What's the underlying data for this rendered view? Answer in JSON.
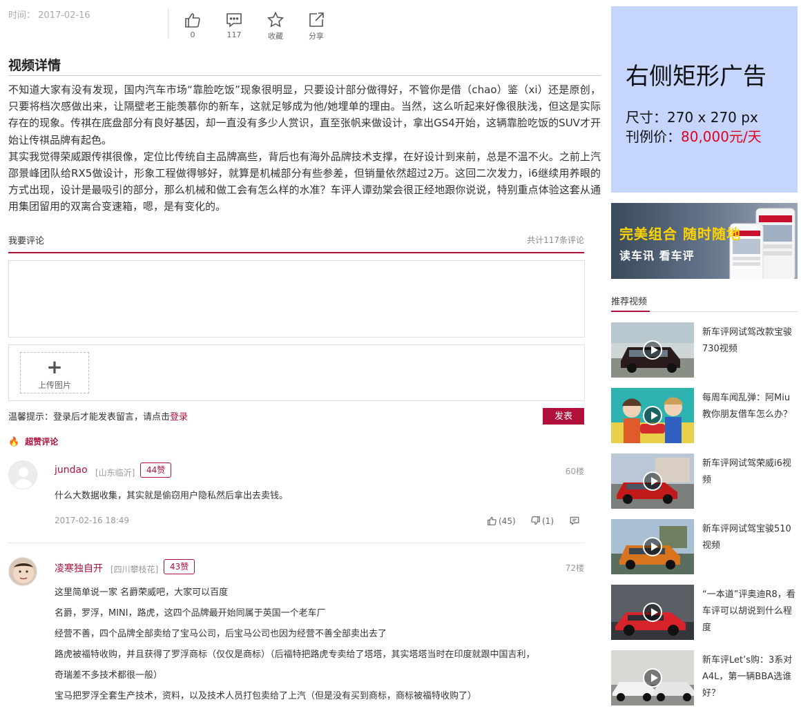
{
  "meta": {
    "time_label": "时间：",
    "time_value": "2017-02-16"
  },
  "actions": [
    {
      "icon": "thumb-up-icon",
      "label": "0"
    },
    {
      "icon": "comment-icon",
      "label": "117"
    },
    {
      "icon": "star-icon",
      "label": "收藏"
    },
    {
      "icon": "share-icon",
      "label": "分享"
    }
  ],
  "section_title": "视频详情",
  "description": [
    "不知道大家有没有发现，国内汽车市场“靠脸吃饭”现象很明显，只要设计部分做得好，不管你是借（chao）鉴（xi）还是原创，只要将档次感做出来，让隔壁老王能羡慕你的新车，这就足够成为他/她埋单的理由。当然，这么听起来好像很肤浅，但这是实际存在的现象。传祺在底盘部分有良好基因，却一直没有多少人赏识，直至张帆来做设计，拿出GS4开始，这辆靠脸吃饭的SUV才开始让传祺品牌有起色。",
    "其实我觉得荣威跟传祺很像，定位比传统自主品牌高些，背后也有海外品牌技术支撑，在好设计到来前，总是不温不火。之前上汽邵景峰团队给RX5做设计，形象工程做得够好，就算是机械部分有些参差，但销量依然超过2万。这回二次发力，i6继续用养眼的方式出现，设计是最吸引的部分，那么机械和做工会有怎么样的水准？车评人谭劲棠会很正经地跟你说说，特别重点体验这套从通用集团留用的双离合变速箱，嗯，是有变化的。"
  ],
  "comment_form": {
    "title": "我要评论",
    "count": "共计117条评论",
    "textarea_placeholder": "",
    "upload_label": "上传图片",
    "upload_plus": "+",
    "tip_prefix": "温馨提示：登录后才能发表留言，请点击",
    "tip_link": "登录",
    "publish_label": "发表"
  },
  "hot_label": "超赞评论",
  "comments": [
    {
      "user": "jundao",
      "location": "[山东临沂]",
      "likes_badge": "44赞",
      "floor": "60楼",
      "lines": [
        "什么大数据收集，其实就是偷窃用户隐私然后拿出去卖钱。"
      ],
      "date": "2017-02-16 18:49",
      "up_count": "(45)",
      "down_count": "(1)"
    },
    {
      "user": "凌寒独自开",
      "location": "[四川攀枝花]",
      "likes_badge": "43赞",
      "floor": "72楼",
      "lines": [
        "这里简单说一家 名爵荣威吧，大家可以百度",
        "名爵，罗浮，MINI，路虎，这四个品牌最开始同属于英国一个老车厂",
        "经营不善，四个品牌全部卖给了宝马公司，后宝马公司也因为经营不善全部卖出去了",
        "路虎被福特收购，并且获得了罗浮商标（仅仅是商标）（后福特把路虎专卖给了塔塔，其实塔塔当时在印度就跟中国吉利，",
        "奇瑞差不多技术都很一般）",
        "宝马把罗浮全套生产技术，资料，以及技术人员打包卖给了上汽（但是没有买到商标，商标被福特收购了）"
      ]
    }
  ],
  "ad_rect": {
    "title": "右侧矩形广告",
    "size": "尺寸：270 x 270 px",
    "price_label": "刊例价：",
    "price_value": "80,000元/天",
    "bg_color": "#c5d5fe",
    "price_color": "#e3001b"
  },
  "ad_banner": {
    "line1": "完美组合 随时随地",
    "line2": "读车讯 看车评"
  },
  "recommend": {
    "title": "推荐视频",
    "items": [
      {
        "title": "新车评网试驾改款宝骏730视频"
      },
      {
        "title": "每周车闻乱弹：阿Miu教你朋友借车怎么办？"
      },
      {
        "title": "新车评网试驾荣威i6视频"
      },
      {
        "title": "新车评网试驾宝骏510视频"
      },
      {
        "title": "“一本道”评奥迪R8，看车评可以胡说到什么程度"
      },
      {
        "title": "新车评Let’s购：3系对A4L，第一辆BBA选谁好？"
      }
    ]
  },
  "colors": {
    "accent": "#b0103a"
  }
}
